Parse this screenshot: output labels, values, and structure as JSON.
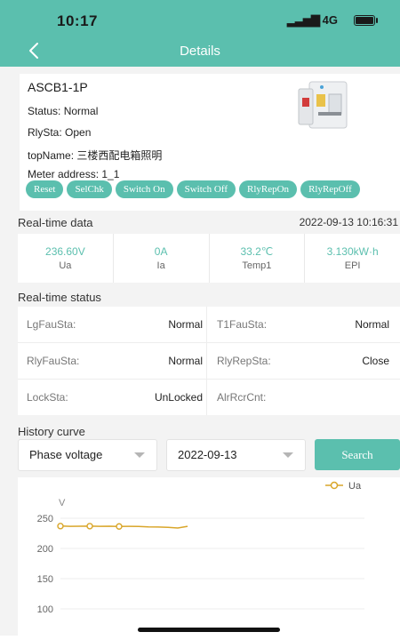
{
  "status_bar": {
    "time": "10:17",
    "network": "4G"
  },
  "nav": {
    "back_icon": "chevron-left-icon",
    "title": "Details"
  },
  "device": {
    "name": "ASCB1-1P",
    "status": "Status: Normal",
    "rly_sta": "RlySta: Open",
    "top_name": "topName: 三楼西配电箱照明",
    "meter_address": "Meter address: 1_1",
    "image_icon": "circuit-breaker-image",
    "actions": [
      "Reset",
      "SelChk",
      "Switch On",
      "Switch Off",
      "RlyRepOn",
      "RlyRepOff"
    ]
  },
  "realtime": {
    "title": "Real-time data",
    "timestamp": "2022-09-13 10:16:31",
    "items": [
      {
        "value": "236.60V",
        "label": "Ua"
      },
      {
        "value": "0A",
        "label": "Ia"
      },
      {
        "value": "33.2℃",
        "label": "Temp1"
      },
      {
        "value": "3.130kW·h",
        "label": "EPI"
      }
    ]
  },
  "status": {
    "title": "Real-time status",
    "rows": [
      [
        {
          "label": "LgFauSta:",
          "value": "Normal"
        },
        {
          "label": "T1FauSta:",
          "value": "Normal"
        }
      ],
      [
        {
          "label": "RlyFauSta:",
          "value": "Normal"
        },
        {
          "label": "RlyRepSta:",
          "value": "Close"
        }
      ],
      [
        {
          "label": "LockSta:",
          "value": "UnLocked"
        },
        {
          "label": "AlrRcrCnt:",
          "value": ""
        }
      ]
    ]
  },
  "history": {
    "title": "History curve",
    "type_select": "Phase voltage",
    "date_select": "2022-09-13",
    "search_label": "Search"
  },
  "colors": {
    "accent": "#5bbfae",
    "series": "#d9a62a"
  },
  "chart_data": {
    "type": "line",
    "ylabel": "V",
    "yticks": [
      250,
      200,
      150,
      100
    ],
    "ylim": [
      90,
      275
    ],
    "legend": "top-right",
    "grid": true,
    "series": [
      {
        "name": "Ua",
        "x": [
          0,
          1,
          2,
          3,
          4,
          5,
          6,
          7,
          8,
          9,
          10,
          11,
          12,
          13
        ],
        "values": [
          237,
          236.6,
          236.7,
          236.9,
          236.6,
          236.8,
          236.4,
          236.6,
          236.5,
          235.8,
          235.5,
          234.8,
          233.8,
          236.6
        ],
        "markers": [
          0,
          3,
          6
        ]
      }
    ]
  }
}
